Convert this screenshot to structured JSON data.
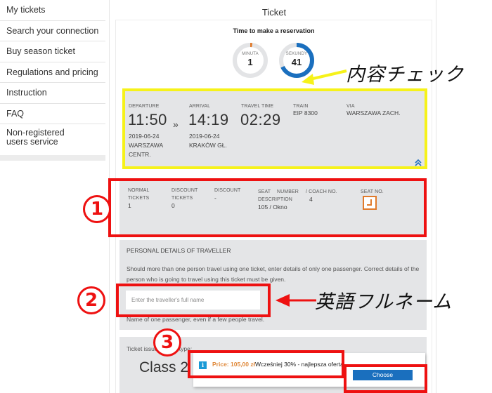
{
  "sidebar": {
    "items": [
      {
        "label": "My tickets"
      },
      {
        "label": "Search your connection"
      },
      {
        "label": "Buy season ticket"
      },
      {
        "label": "Regulations and pricing"
      },
      {
        "label": "Instruction"
      },
      {
        "label": "FAQ"
      },
      {
        "label": "Non-registered users service"
      }
    ]
  },
  "page": {
    "title": "Ticket"
  },
  "timer": {
    "title": "Time to make a reservation",
    "minutes": {
      "label": "MINUTA",
      "value": "1",
      "fraction": 0.02,
      "color": "#e07a2b"
    },
    "seconds": {
      "label": "SEKUNDY",
      "value": "41",
      "fraction": 0.68,
      "color": "#1a6fbe"
    }
  },
  "journey": {
    "departure_label": "DEPARTURE",
    "departure_time": "11:50",
    "departure_date": "2019-06-24",
    "departure_station": "WARSZAWA CENTR.",
    "separator": "»",
    "arrival_label": "ARRIVAL",
    "arrival_time": "14:19",
    "arrival_date": "2019-06-24",
    "arrival_station": "KRAKÓW GŁ.",
    "travel_time_label": "TRAVEL TIME",
    "travel_time": "02:29",
    "train_label": "TRAIN",
    "train": "EIP 8300",
    "via_label": "VIA",
    "via": "WARSZAWA ZACH.",
    "collapse_icon": "double-chevron-up"
  },
  "tickets": {
    "normal_label": "NORMAL TICKETS",
    "normal_value": "1",
    "discount_tickets_label": "DISCOUNT TICKETS",
    "discount_tickets_value": "0",
    "discount_label": "DISCOUNT",
    "discount_value": "-",
    "seat_desc_label_1": "SEAT",
    "seat_desc_label_2": "NUMBER",
    "seat_desc_label_3": "DESCRIPTION",
    "seat_desc_value": "105 / Okno",
    "coach_label": "/ COACH NO.",
    "coach_value": "4",
    "seat_no_label": "SEAT NO.",
    "seat_icon": "seat-icon"
  },
  "personal": {
    "heading": "PERSONAL DETAILS OF TRAVELLER",
    "text": "Should more than one person travel using one ticket, enter details of only one passenger. Correct details of the person who is going to travel using this ticket must be given.",
    "name_placeholder": "Enter the traveller's full name",
    "name_value": "",
    "hint": "Name of one passenger, even if a few people travel."
  },
  "offer": {
    "issued_label": "Ticket issued in the type:",
    "class_label": "Class 2",
    "info_icon": "i",
    "price": "Price: 105,00 zł",
    "promo": "Wcześniej 30% - najlepsza oferta",
    "choose_label": "Choose"
  },
  "annotations": {
    "content_check": "内容チェック",
    "full_name_english": "英語フルネーム",
    "step1": "1",
    "step2": "2",
    "step3": "3",
    "colors": {
      "yellow": "#f6f21a",
      "red": "#ee1111"
    }
  }
}
